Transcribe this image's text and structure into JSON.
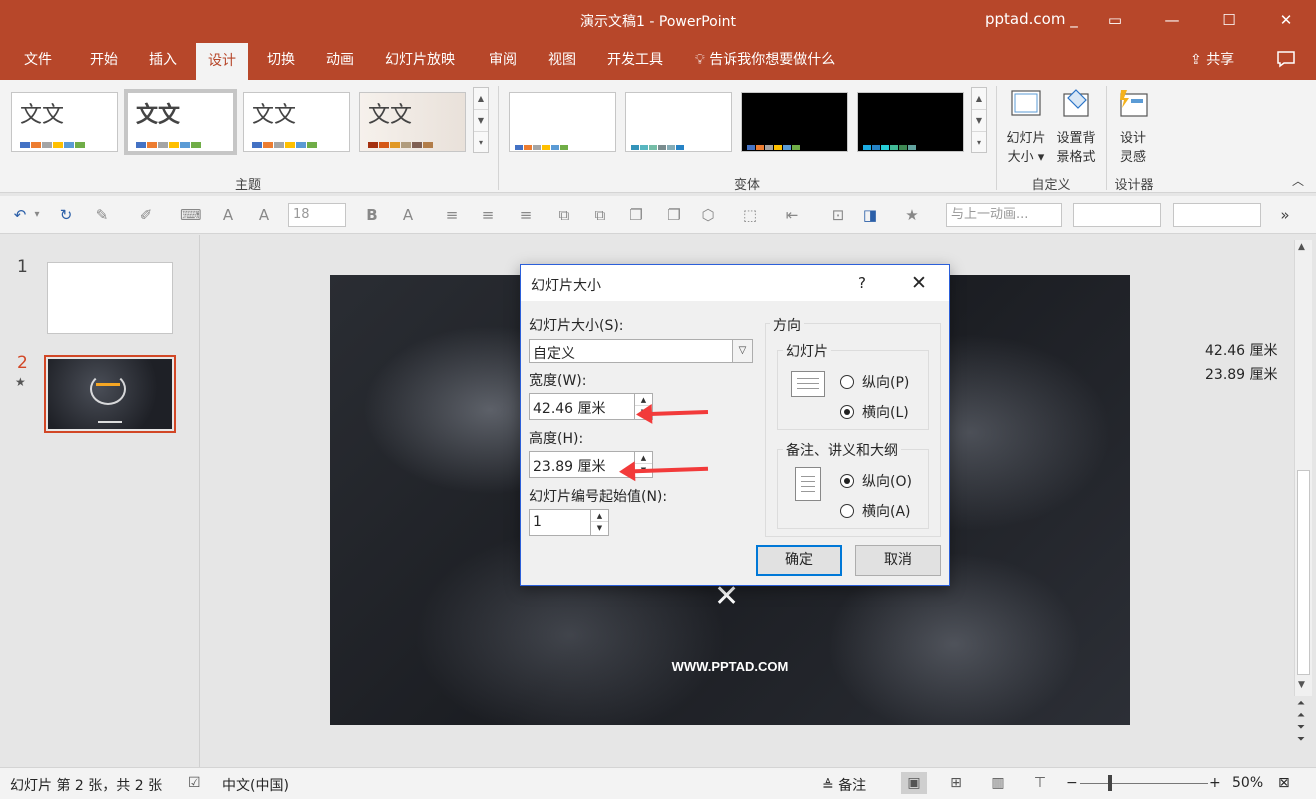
{
  "app": {
    "title": "演示文稿1  -  PowerPoint",
    "site": "pptad.com _"
  },
  "menu": {
    "tabs": [
      "文件",
      "开始",
      "插入",
      "设计",
      "切换",
      "动画",
      "幻灯片放映",
      "审阅",
      "视图",
      "开发工具"
    ],
    "active": "设计",
    "tell": "告诉我你想要做什么",
    "share": "共享"
  },
  "ribbon": {
    "theme_label": "主题",
    "variant_label": "变体",
    "customize_label": "自定义",
    "designer_label": "设计器",
    "theme_text": "文文",
    "slide_size_line1": "幻灯片",
    "slide_size_line2": "大小 ▾",
    "bg_format_line1": "设置背",
    "bg_format_line2": "景格式",
    "design_ideas_line1": "设计",
    "design_ideas_line2": "灵感"
  },
  "toolbar": {
    "font_size": "18",
    "anim_box": "与上一动画..."
  },
  "thumbs": {
    "n1": "1",
    "n2": "2",
    "star": "★"
  },
  "slide": {
    "website": "WWW.PPTAD.COM",
    "mark": "✕"
  },
  "info": {
    "width": "42.46 厘米",
    "height": "23.89 厘米"
  },
  "dialog": {
    "title": "幻灯片大小",
    "help": "?",
    "close": "✕",
    "size_label": "幻灯片大小(S):",
    "size_value": "自定义",
    "width_label": "宽度(W):",
    "width_value": "42.46 厘米",
    "height_label": "高度(H):",
    "height_value": "23.89 厘米",
    "start_label": "幻灯片编号起始值(N):",
    "start_value": "1",
    "orientation_label": "方向",
    "slides_group": "幻灯片",
    "portrait_p": "纵向(P)",
    "landscape_l": "横向(L)",
    "notes_group": "备注、讲义和大纲",
    "portrait_o": "纵向(O)",
    "landscape_a": "横向(A)",
    "ok": "确定",
    "cancel": "取消"
  },
  "status": {
    "slide_info": "幻灯片 第 2 张，共 2 张",
    "language": "中文(中国)",
    "notes": "备注",
    "zoom": "50%"
  },
  "colors": {
    "accent": "#b7472a",
    "dialog_border": "#2b5fd9",
    "arrow": "#f23a3a"
  }
}
